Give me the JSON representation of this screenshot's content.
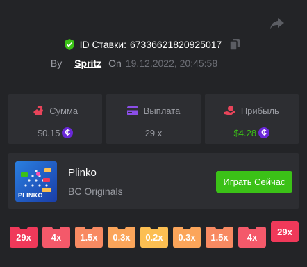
{
  "bet": {
    "id_label": "ID Ставки:",
    "id_value": "67336621820925017"
  },
  "meta": {
    "by_label": "By",
    "user": "Spritz",
    "on_label": "On",
    "datetime": "19.12.2022, 20:45:58"
  },
  "stats": [
    {
      "label": "Сумма",
      "value": "$0.15",
      "icon": "bet-amount-icon",
      "has_coin": true,
      "color": "#9a9ca3"
    },
    {
      "label": "Выплата",
      "value": "29 x",
      "icon": "payout-card-icon",
      "has_coin": false,
      "color": "#9a9ca3"
    },
    {
      "label": "Прибыль",
      "value": "$4.28",
      "icon": "profit-hand-icon",
      "has_coin": true,
      "color": "#3bc117"
    }
  ],
  "coin_symbol": "₵",
  "game": {
    "thumb_text": "PLINKO",
    "name": "Plinko",
    "provider": "BC Originals",
    "play_label": "Играть Сейчас"
  },
  "multipliers": [
    {
      "label": "29x",
      "color": "#f0395a"
    },
    {
      "label": "4x",
      "color": "#f4596a"
    },
    {
      "label": "1.5x",
      "color": "#f88a62"
    },
    {
      "label": "0.3x",
      "color": "#fba55a"
    },
    {
      "label": "0.2x",
      "color": "#fcbf52"
    },
    {
      "label": "0.3x",
      "color": "#fba55a"
    },
    {
      "label": "1.5x",
      "color": "#f88a62"
    },
    {
      "label": "4x",
      "color": "#f4596a"
    },
    {
      "label": "29x",
      "color": "#f0395a",
      "hit": true
    }
  ],
  "colors": {
    "background": "#232427",
    "panel": "#2d2e32",
    "accent_green": "#3bc117",
    "coin_purple": "#6a28d8"
  }
}
